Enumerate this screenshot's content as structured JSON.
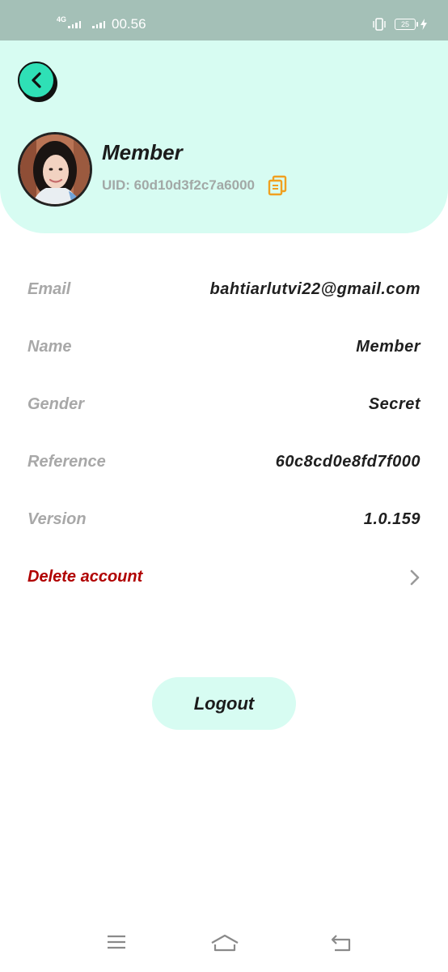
{
  "status_bar": {
    "network": "4G",
    "time": "00.56",
    "battery": "25"
  },
  "header": {
    "name": "Member",
    "uid": "UID: 60d10d3f2c7a6000"
  },
  "info_rows": [
    {
      "label": "Email",
      "value": "bahtiarlutvi22@gmail.com"
    },
    {
      "label": "Name",
      "value": "Member"
    },
    {
      "label": "Gender",
      "value": "Secret"
    },
    {
      "label": "Reference",
      "value": "60c8cd0e8fd7f000"
    },
    {
      "label": "Version",
      "value": "1.0.159"
    }
  ],
  "delete_account": {
    "label": "Delete account"
  },
  "logout": {
    "label": "Logout"
  },
  "icons": {
    "back": "chevron-left-icon",
    "copy": "copy-icon",
    "chevron": "chevron-right-icon",
    "nav_menu": "menu-icon",
    "nav_home": "home-icon",
    "nav_back": "back-arrow-icon"
  },
  "colors": {
    "accent": "#2fe0b6",
    "header_bg": "#d7fcf2",
    "status_bar_bg": "#a4c0b7",
    "danger": "#b00000",
    "copy_icon": "#f0a020"
  }
}
